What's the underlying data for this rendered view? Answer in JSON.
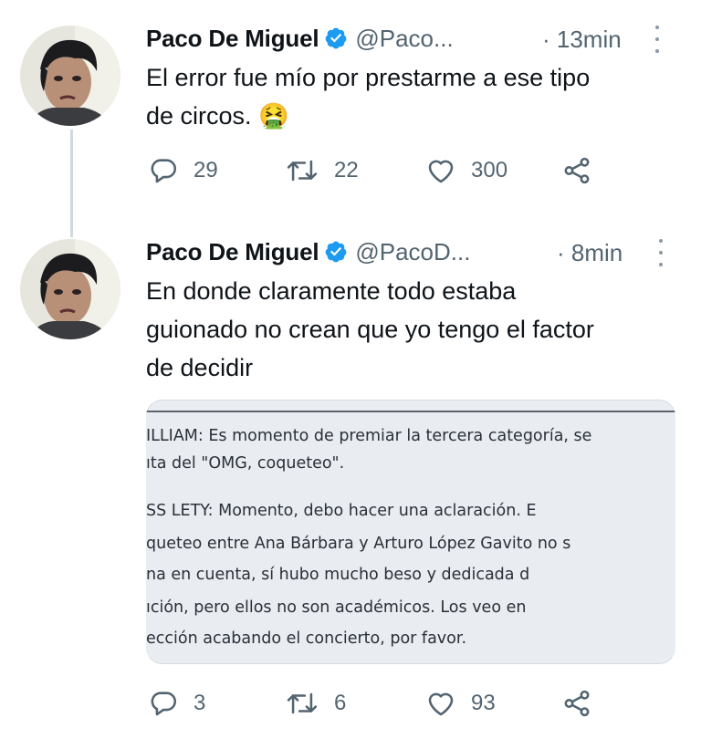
{
  "tweets": [
    {
      "name": "Paco De Miguel",
      "handle": "@Paco...",
      "time": "· 13min",
      "text_lines": [
        "El error fue mío por prestarme a ese tipo",
        "de circos. 🤮"
      ],
      "replies": "29",
      "retweets": "22",
      "likes": "300"
    },
    {
      "name": "Paco De Miguel",
      "handle": "@PacoD...",
      "time": "· 8min",
      "text_lines": [
        "En donde claramente todo estaba",
        "guionado no crean que yo tengo el factor",
        "de decidir"
      ],
      "replies": "3",
      "retweets": "6",
      "likes": "93",
      "media_lines": [
        "ILLIAM: Es momento de premiar la tercera categoría, se",
        "ıta del \"OMG, coqueteo\".",
        "SS LETY: Momento, debo hacer una aclaración. E",
        "queteo entre Ana Bárbara y Arturo López Gavito no s",
        "na en cuenta, sí hubo mucho beso y dedicada d",
        "ıción, pero ellos no son académicos. Los veo en",
        "ección acabando el concierto, por favor."
      ]
    }
  ],
  "colors": {
    "text": "#0f1419",
    "secondary": "#536471",
    "verified": "#1d9bf0",
    "thread_line": "#cfd9de"
  },
  "icons": [
    "reply-icon",
    "retweet-icon",
    "like-icon",
    "share-icon",
    "verified-badge-icon",
    "more-icon"
  ]
}
